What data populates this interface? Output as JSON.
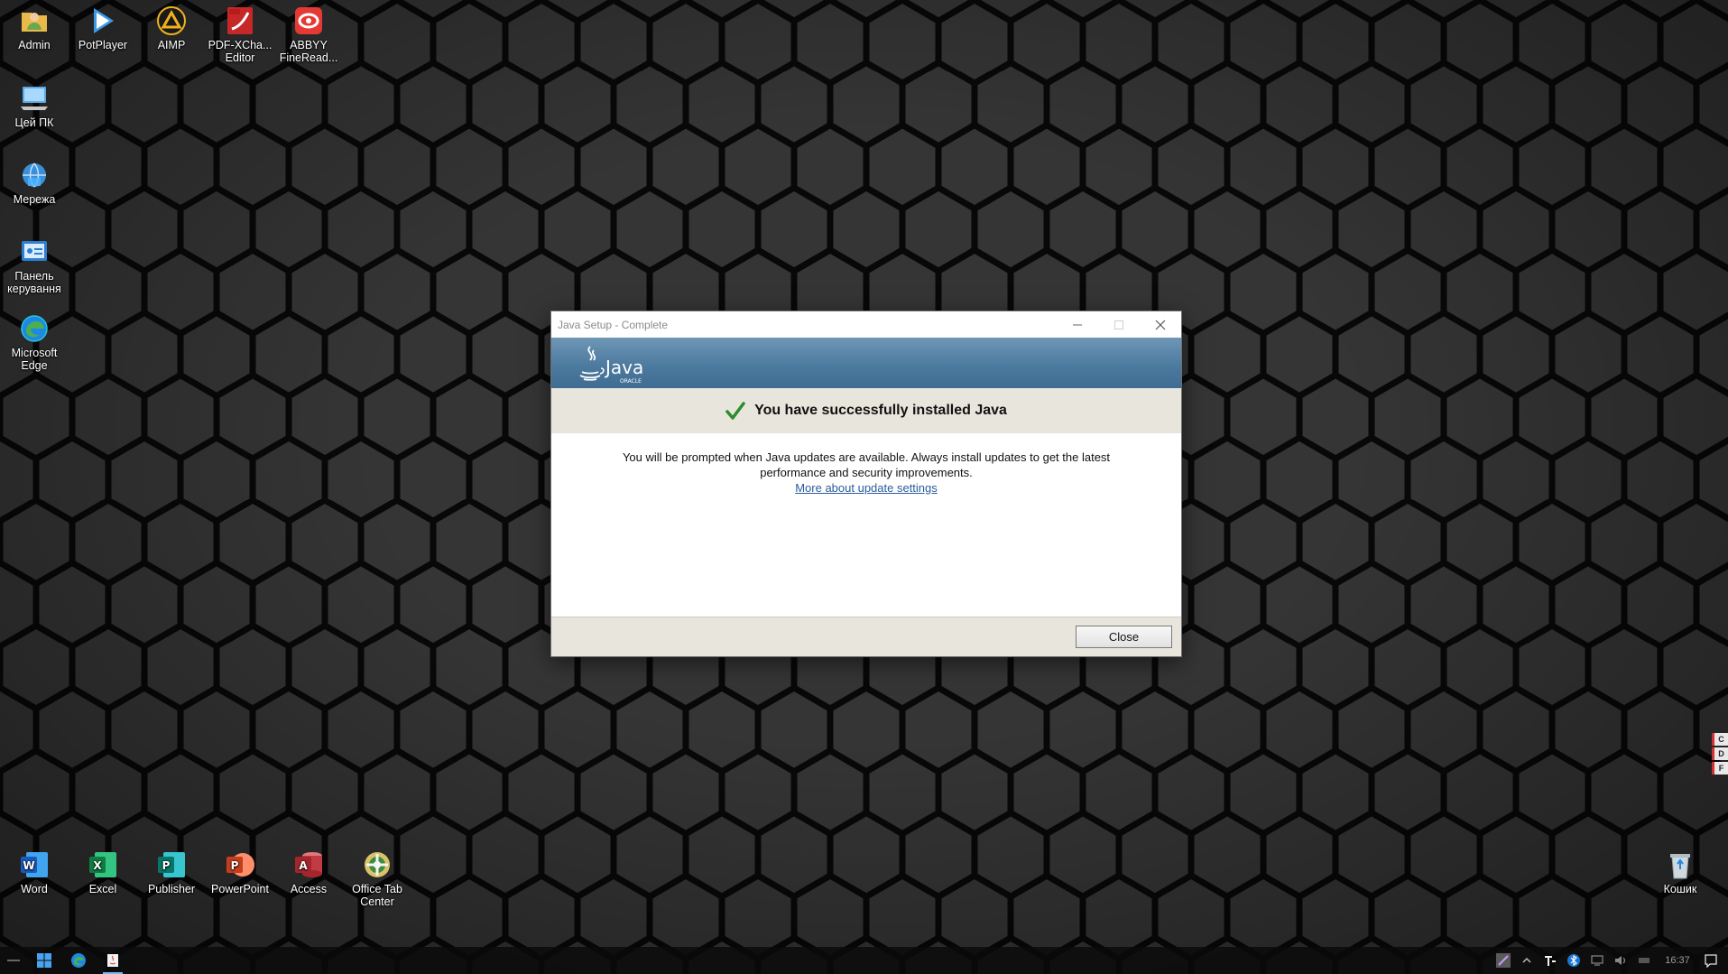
{
  "desktop": {
    "icons_top": [
      {
        "label": "Admin"
      },
      {
        "label": "PotPlayer"
      },
      {
        "label": "AIMP"
      },
      {
        "label": "PDF-XCha... Editor"
      },
      {
        "label": "ABBYY FineRead..."
      }
    ],
    "icons_left": [
      {
        "label": "Цей ПК"
      },
      {
        "label": "Мережа"
      },
      {
        "label": "Панель керування"
      },
      {
        "label": "Microsoft Edge"
      }
    ],
    "icons_bottom": [
      {
        "label": "Word"
      },
      {
        "label": "Excel"
      },
      {
        "label": "Publisher"
      },
      {
        "label": "PowerPoint"
      },
      {
        "label": "Access"
      },
      {
        "label": "Office Tab Center"
      }
    ],
    "recycle_bin": {
      "label": "Кошик"
    }
  },
  "dialog": {
    "title": "Java Setup - Complete",
    "banner_logo": "Java",
    "banner_sub": "ORACLE",
    "heading": "You have successfully installed Java",
    "message": "You will be prompted when Java updates are available. Always install updates to get the latest performance and security improvements.",
    "link": "More about update settings",
    "close_button": "Close"
  },
  "taskbar": {
    "clock": "16:37"
  },
  "edge_widget": [
    "C",
    "D",
    "F"
  ],
  "colors": {
    "banner": "#4d7a9f",
    "status_strip": "#e8e6dc",
    "check": "#2e8b2e",
    "link": "#2a5d9c"
  }
}
